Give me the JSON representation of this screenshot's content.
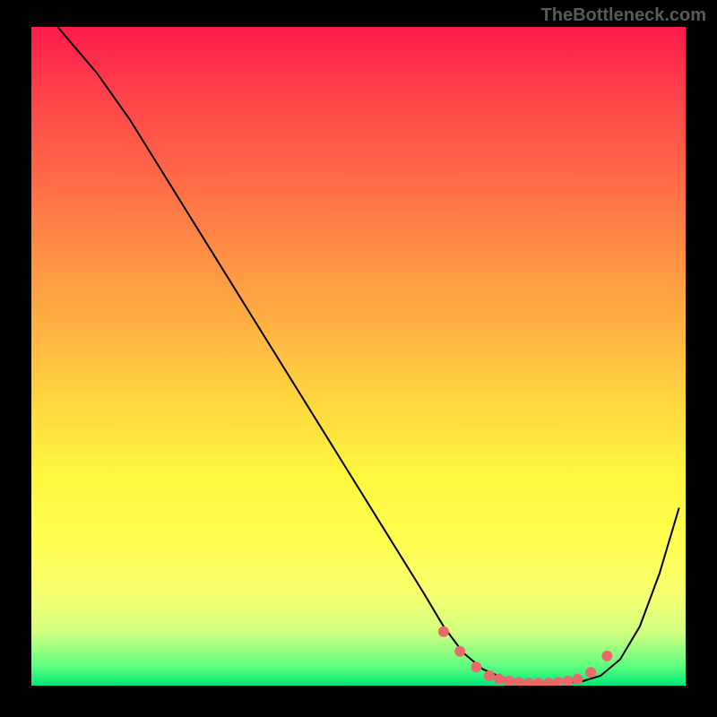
{
  "watermark": "TheBottleneck.com",
  "chart_data": {
    "type": "line",
    "title": "",
    "xlabel": "",
    "ylabel": "",
    "xlim": [
      0,
      100
    ],
    "ylim": [
      0,
      100
    ],
    "series": [
      {
        "name": "curve",
        "x": [
          4,
          10,
          15,
          20,
          25,
          30,
          35,
          40,
          45,
          50,
          55,
          60,
          63,
          66,
          69,
          72,
          75,
          78,
          81,
          84,
          87,
          90,
          93,
          96,
          99
        ],
        "values": [
          100,
          93,
          86,
          78,
          70,
          62,
          54,
          46,
          38,
          30,
          22,
          14,
          9,
          5,
          2.5,
          1.2,
          0.6,
          0.4,
          0.4,
          0.6,
          1.5,
          4,
          9,
          17,
          27
        ]
      }
    ],
    "markers": {
      "name": "dotted-bottom",
      "x": [
        63,
        65.5,
        68,
        70,
        71.5,
        73,
        74.5,
        76,
        77.5,
        79,
        80.5,
        82,
        83.5,
        85.5,
        88
      ],
      "values": [
        8.2,
        5.2,
        2.8,
        1.5,
        1.0,
        0.7,
        0.5,
        0.4,
        0.4,
        0.4,
        0.5,
        0.7,
        1.0,
        2.0,
        4.5
      ],
      "color": "#e96a6a",
      "size": 6
    },
    "background": {
      "type": "vertical-gradient",
      "stops": [
        {
          "pos": 0.0,
          "color": "#ff1a4a"
        },
        {
          "pos": 0.5,
          "color": "#ffba42"
        },
        {
          "pos": 0.8,
          "color": "#ffff50"
        },
        {
          "pos": 1.0,
          "color": "#00e878"
        }
      ]
    }
  }
}
